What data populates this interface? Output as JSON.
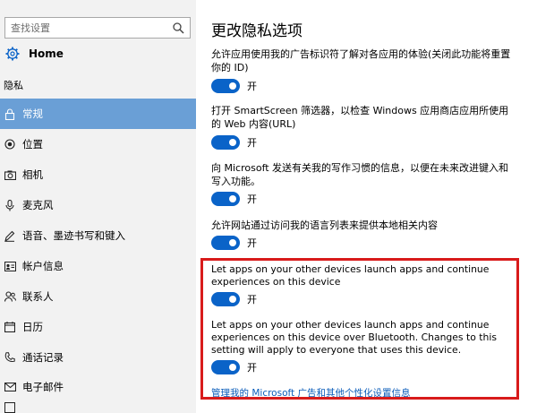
{
  "sidebar": {
    "search_placeholder": "查找设置",
    "home_label": "Home",
    "section_label": "隐私",
    "items": [
      {
        "label": "常规",
        "icon": "lock-icon"
      },
      {
        "label": "位置",
        "icon": "location-icon"
      },
      {
        "label": "相机",
        "icon": "camera-icon"
      },
      {
        "label": "麦克风",
        "icon": "microphone-icon"
      },
      {
        "label": "语音、墨迹书写和键入",
        "icon": "speech-icon"
      },
      {
        "label": "帐户信息",
        "icon": "account-icon"
      },
      {
        "label": "联系人",
        "icon": "contacts-icon"
      },
      {
        "label": "日历",
        "icon": "calendar-icon"
      },
      {
        "label": "通话记录",
        "icon": "call-history-icon"
      },
      {
        "label": "电子邮件",
        "icon": "email-icon"
      }
    ]
  },
  "main": {
    "title": "更改隐私选项",
    "options": [
      {
        "text": "允许应用使用我的广告标识符了解对各应用的体验(关闭此功能将重置你的 ID)",
        "state": "开"
      },
      {
        "text": "打开 SmartScreen 筛选器，以检查 Windows 应用商店应用所使用的 Web 内容(URL)",
        "state": "开"
      },
      {
        "text": "向 Microsoft 发送有关我的写作习惯的信息，以便在未来改进键入和写入功能。",
        "state": "开"
      },
      {
        "text": "允许网站通过访问我的语言列表来提供本地相关内容",
        "state": "开"
      },
      {
        "text": "Let apps on your other devices launch apps and continue experiences on this device",
        "state": "开"
      },
      {
        "text": "Let apps on your other devices launch apps and continue experiences on this device over Bluetooth. Changes to this setting will apply to everyone that uses this device.",
        "state": "开"
      }
    ],
    "link": "管理我的 Microsoft 广告和其他个性化设置信息"
  },
  "colors": {
    "accent": "#0a63c8",
    "active_nav": "#6a9fd6",
    "highlight": "#d81b1b",
    "link": "#0a5cba"
  }
}
